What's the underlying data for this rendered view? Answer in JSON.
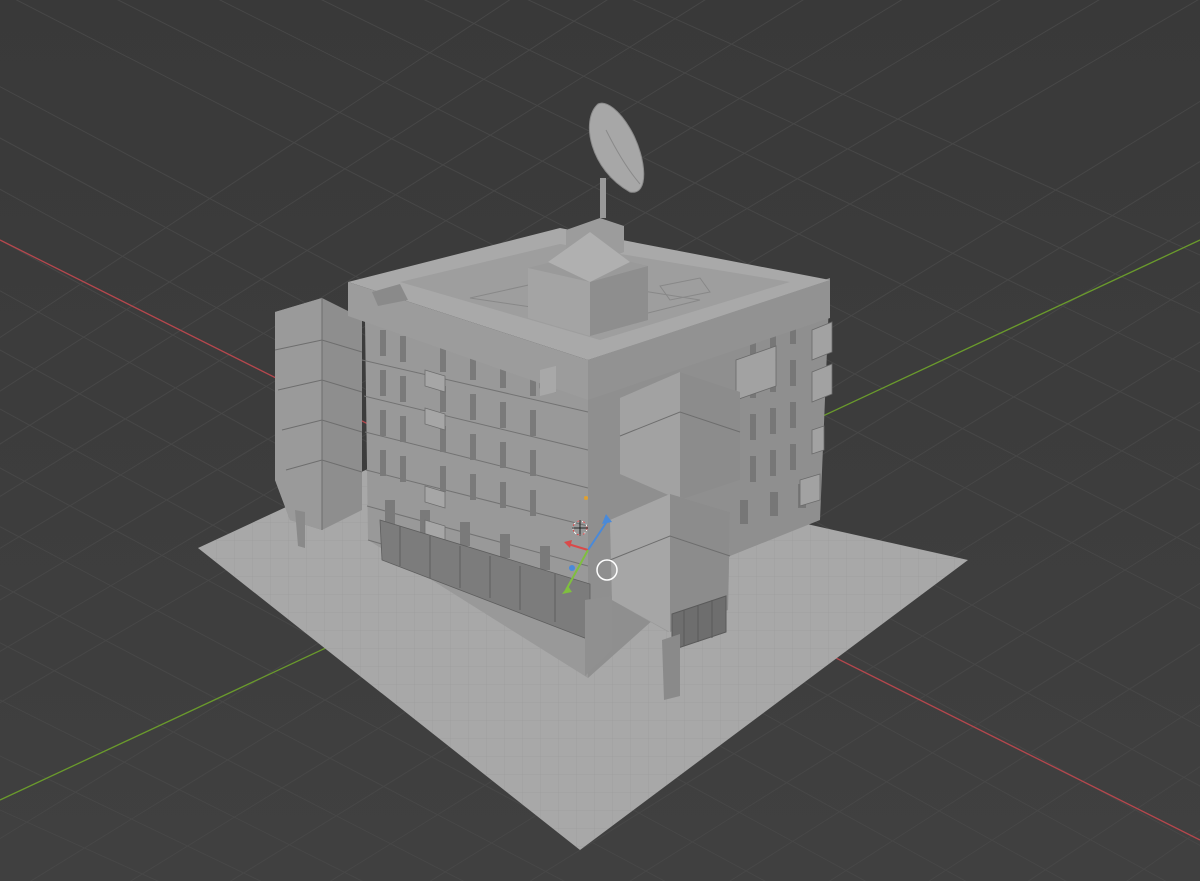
{
  "viewport": {
    "background": "#3d3d3d",
    "grid_color": "#4a4a4a",
    "x_axis_color": "#b5474d",
    "y_axis_color": "#6a9a2c"
  },
  "scene": {
    "objects": [
      "ground-plane",
      "apartment-building",
      "satellite-dish"
    ],
    "plane_color": "#a3a3a3",
    "building_color": "#8c8c8c"
  },
  "gizmo": {
    "icons": [
      "3d-cursor-icon",
      "transform-gizmo-icon",
      "object-origin-icon"
    ],
    "x_color": "#d94a4a",
    "y_color": "#7fbf3f",
    "z_color": "#4a8ad9"
  }
}
